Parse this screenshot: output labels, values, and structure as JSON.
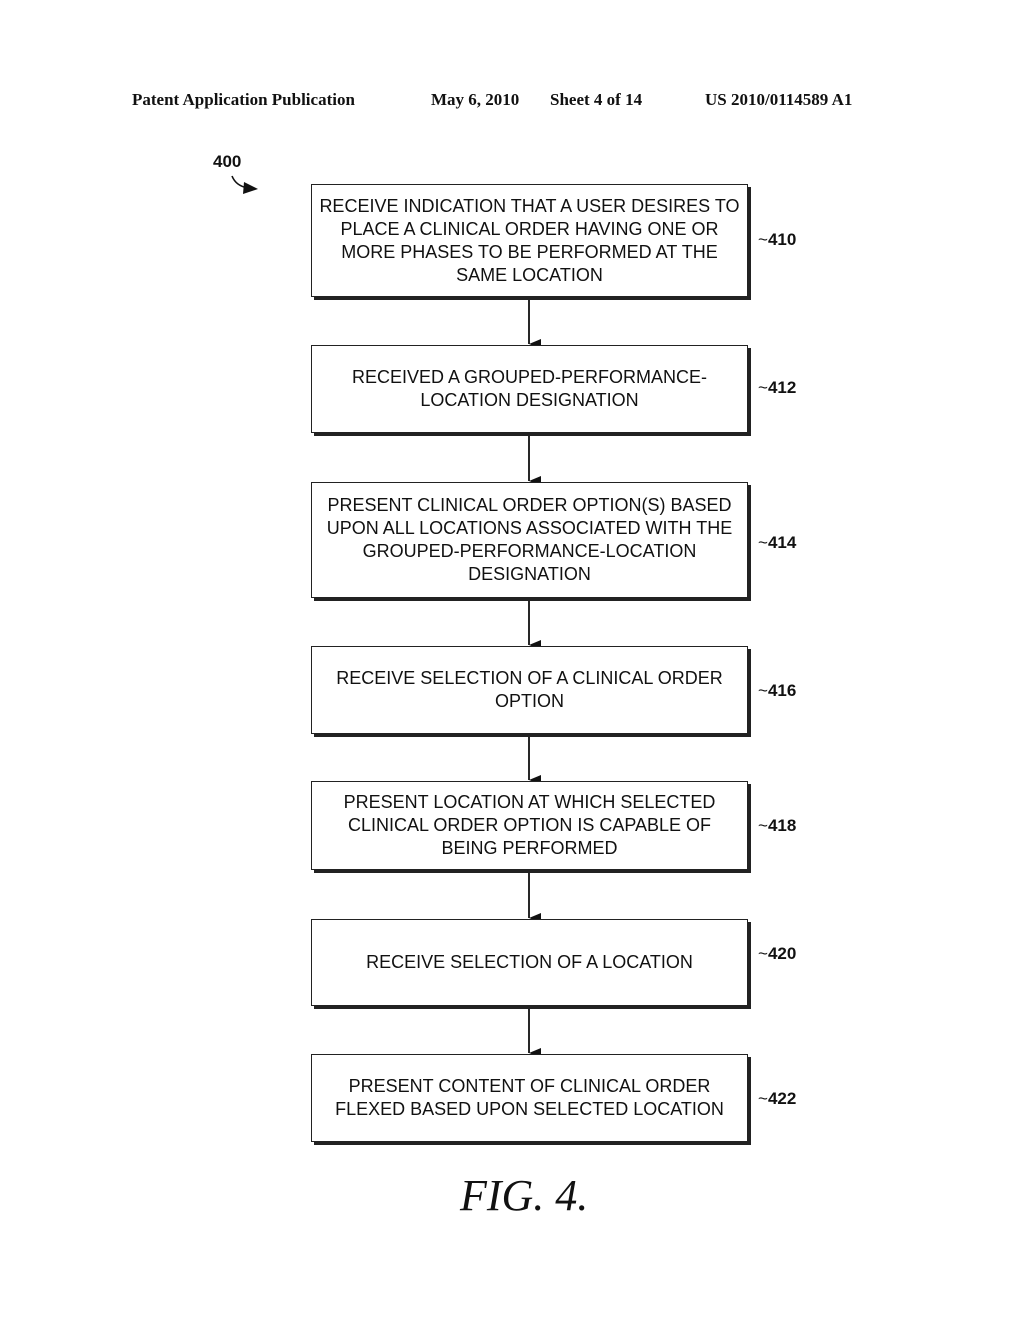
{
  "header": {
    "publication": "Patent Application Publication",
    "date": "May 6, 2010",
    "sheet": "Sheet 4 of 14",
    "number": "US 2010/0114589 A1"
  },
  "figure": {
    "reference": "400",
    "caption": "FIG. 4."
  },
  "steps": [
    {
      "id": "410",
      "text": "RECEIVE INDICATION THAT A USER DESIRES TO PLACE A CLINICAL ORDER HAVING ONE OR MORE PHASES TO BE PERFORMED AT THE SAME LOCATION"
    },
    {
      "id": "412",
      "text": "RECEIVED A GROUPED-PERFORMANCE-LOCATION DESIGNATION"
    },
    {
      "id": "414",
      "text": "PRESENT CLINICAL ORDER OPTION(S) BASED UPON ALL LOCATIONS ASSOCIATED WITH THE GROUPED-PERFORMANCE-LOCATION DESIGNATION"
    },
    {
      "id": "416",
      "text": "RECEIVE SELECTION OF A CLINICAL ORDER OPTION"
    },
    {
      "id": "418",
      "text": "PRESENT LOCATION AT WHICH SELECTED CLINICAL ORDER OPTION IS CAPABLE OF BEING PERFORMED"
    },
    {
      "id": "420",
      "text": "RECEIVE SELECTION OF A LOCATION"
    },
    {
      "id": "422",
      "text": "PRESENT CONTENT OF CLINICAL ORDER FLEXED BASED UPON SELECTED LOCATION"
    }
  ]
}
